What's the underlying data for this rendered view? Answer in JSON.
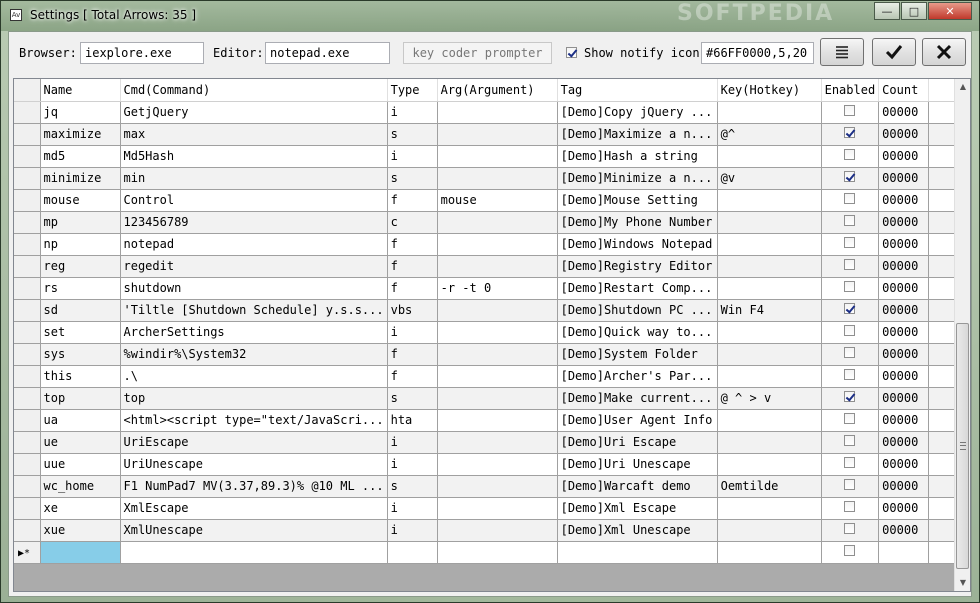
{
  "window": {
    "title": "Settings [ Total Arrows: 35 ]",
    "app_icon": "Av",
    "watermark": "SOFTPEDIA"
  },
  "toolbar": {
    "browser_label": "Browser:",
    "browser_value": "iexplore.exe",
    "editor_label": "Editor:",
    "editor_value": "notepad.exe",
    "key_coder_label": "key coder prompter",
    "show_notify_label": "Show notify icon",
    "show_notify_checked": true,
    "notify_value": "#66FF0000,5,20",
    "menu_icon": "list-icon",
    "ok_icon": "checkmark-icon",
    "cancel_icon": "close-x-icon"
  },
  "grid": {
    "columns": [
      "Name",
      "Cmd(Command)",
      "Type",
      "Arg(Argument)",
      "Tag",
      "Key(Hotkey)",
      "Enabled",
      "Count"
    ],
    "rows": [
      {
        "name": "jq",
        "cmd": "GetjQuery",
        "type": "i",
        "arg": "",
        "tag": "[Demo]Copy jQuery ...",
        "key": "",
        "enabled": false,
        "count": "00000"
      },
      {
        "name": "maximize",
        "cmd": "max",
        "type": "s",
        "arg": "",
        "tag": "[Demo]Maximize a n...",
        "key": "@^",
        "enabled": true,
        "count": "00000"
      },
      {
        "name": "md5",
        "cmd": "Md5Hash",
        "type": "i",
        "arg": "",
        "tag": "[Demo]Hash a string",
        "key": "",
        "enabled": false,
        "count": "00000"
      },
      {
        "name": "minimize",
        "cmd": "min",
        "type": "s",
        "arg": "",
        "tag": "[Demo]Minimize a n...",
        "key": "@v",
        "enabled": true,
        "count": "00000"
      },
      {
        "name": "mouse",
        "cmd": "Control",
        "type": "f",
        "arg": "mouse",
        "tag": "[Demo]Mouse Setting",
        "key": "",
        "enabled": false,
        "count": "00000"
      },
      {
        "name": "mp",
        "cmd": "123456789",
        "type": "c",
        "arg": "",
        "tag": "[Demo]My Phone Number",
        "key": "",
        "enabled": false,
        "count": "00000"
      },
      {
        "name": "np",
        "cmd": "notepad",
        "type": "f",
        "arg": "",
        "tag": "[Demo]Windows Notepad",
        "key": "",
        "enabled": false,
        "count": "00000"
      },
      {
        "name": "reg",
        "cmd": "regedit",
        "type": "f",
        "arg": "",
        "tag": "[Demo]Registry Editor",
        "key": "",
        "enabled": false,
        "count": "00000"
      },
      {
        "name": "rs",
        "cmd": "shutdown",
        "type": "f",
        "arg": "-r -t 0",
        "tag": "[Demo]Restart Comp...",
        "key": "",
        "enabled": false,
        "count": "00000"
      },
      {
        "name": "sd",
        "cmd": "'Tiltle [Shutdown Schedule] y.s.s...",
        "type": "vbs",
        "arg": "",
        "tag": "[Demo]Shutdown PC ...",
        "key": "Win F4",
        "enabled": true,
        "count": "00000"
      },
      {
        "name": "set",
        "cmd": "ArcherSettings",
        "type": "i",
        "arg": "",
        "tag": "[Demo]Quick way to...",
        "key": "",
        "enabled": false,
        "count": "00000"
      },
      {
        "name": "sys",
        "cmd": "%windir%\\System32",
        "type": "f",
        "arg": "",
        "tag": "[Demo]System Folder",
        "key": "",
        "enabled": false,
        "count": "00000"
      },
      {
        "name": "this",
        "cmd": ".\\",
        "type": "f",
        "arg": "",
        "tag": "[Demo]Archer's Par...",
        "key": "",
        "enabled": false,
        "count": "00000"
      },
      {
        "name": "top",
        "cmd": "top",
        "type": "s",
        "arg": "",
        "tag": "[Demo]Make current...",
        "key": "@ ^ > v",
        "enabled": true,
        "count": "00000"
      },
      {
        "name": "ua",
        "cmd": "<html><script type=\"text/JavaScri...",
        "type": "hta",
        "arg": "",
        "tag": "[Demo]User Agent Info",
        "key": "",
        "enabled": false,
        "count": "00000"
      },
      {
        "name": "ue",
        "cmd": "UriEscape",
        "type": "i",
        "arg": "",
        "tag": "[Demo]Uri Escape",
        "key": "",
        "enabled": false,
        "count": "00000"
      },
      {
        "name": "uue",
        "cmd": "UriUnescape",
        "type": "i",
        "arg": "",
        "tag": "[Demo]Uri Unescape",
        "key": "",
        "enabled": false,
        "count": "00000"
      },
      {
        "name": "wc_home",
        "cmd": "F1 NumPad7 MV(3.37,89.3)% @10 ML ...",
        "type": "s",
        "arg": "",
        "tag": "[Demo]Warcaft demo",
        "key": "Oemtilde",
        "enabled": false,
        "count": "00000"
      },
      {
        "name": "xe",
        "cmd": "XmlEscape",
        "type": "i",
        "arg": "",
        "tag": "[Demo]Xml Escape",
        "key": "",
        "enabled": false,
        "count": "00000"
      },
      {
        "name": "xue",
        "cmd": "XmlUnescape",
        "type": "i",
        "arg": "",
        "tag": "[Demo]Xml Unescape",
        "key": "",
        "enabled": false,
        "count": "00000"
      }
    ],
    "new_row_marker": "▶*"
  },
  "colors": {
    "selected_new_cell": "#87cde8",
    "checkbox_mark": "#1c2f86"
  }
}
